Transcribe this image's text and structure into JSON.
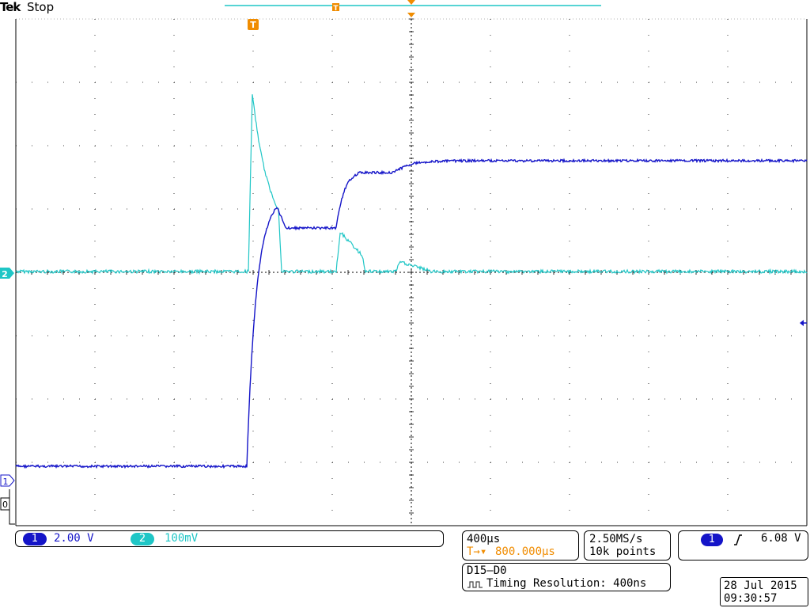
{
  "header": {
    "brand": "Tek",
    "acq_state": "Stop"
  },
  "colors": {
    "ch1": "#1414c8",
    "ch2": "#1fc6c6",
    "trigger": "#f08c00",
    "grid": "#000000"
  },
  "markers": {
    "trigger_marker": "T",
    "ch2_ground": "2",
    "ch1_ground": "1",
    "digital_ground": "0"
  },
  "channels": [
    {
      "id": "1",
      "scale": "2.00 V"
    },
    {
      "id": "2",
      "scale": "100mV"
    }
  ],
  "horizontal": {
    "time_div": "400µs",
    "delay_prefix": "T→▾",
    "delay": "800.000µs"
  },
  "acquisition": {
    "sample_rate": "2.50MS/s",
    "record_length": "10k points"
  },
  "trigger": {
    "source": "1",
    "slope_icon": "rising-edge-icon",
    "level": "6.08 V"
  },
  "digital": {
    "group": "D15–D0",
    "timing_label": "Timing Resolution: 400ns"
  },
  "datetime": {
    "date": "28 Jul  2015",
    "time": "09:30:57"
  }
}
